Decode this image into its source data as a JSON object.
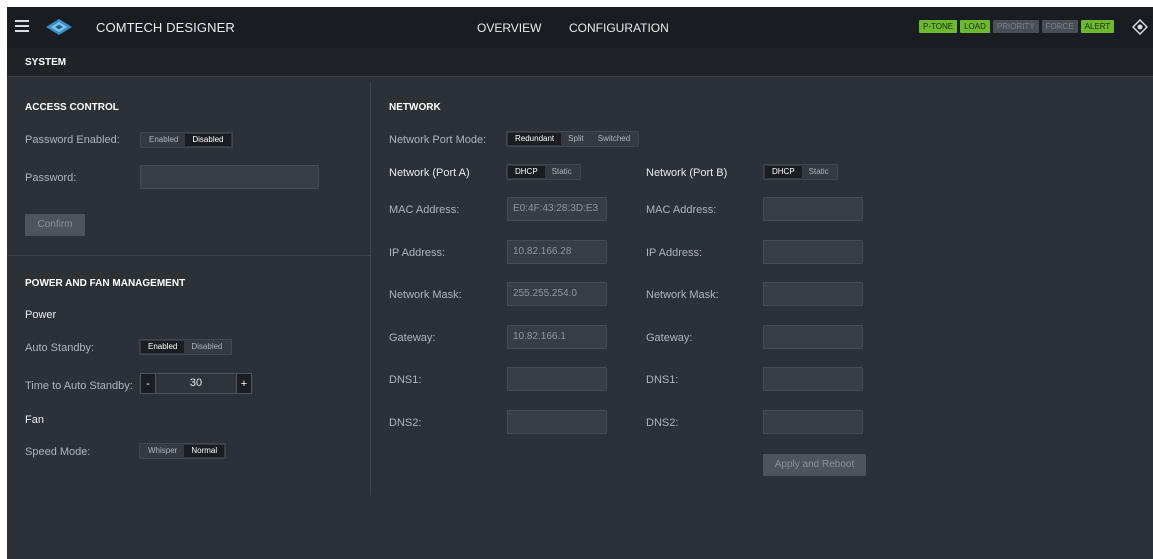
{
  "header": {
    "brand": "COMTECH DESIGNER",
    "nav": {
      "overview": "OVERVIEW",
      "configuration": "CONFIGURATION"
    },
    "badges": [
      {
        "label": "P-TONE",
        "active": true
      },
      {
        "label": "LOAD",
        "active": true
      },
      {
        "label": "PRIORITY",
        "active": false
      },
      {
        "label": "FORCE",
        "active": false
      },
      {
        "label": "ALERT",
        "active": true
      }
    ],
    "colors": {
      "bar": "#191c20",
      "active_badge": "#6db92d",
      "inactive_badge": "#494e55"
    }
  },
  "system": {
    "title": "SYSTEM"
  },
  "access_control": {
    "title": "ACCESS CONTROL",
    "password_enabled_label": "Password Enabled:",
    "password_enabled_options": [
      "Enabled",
      "Disabled"
    ],
    "password_enabled_selected": "Disabled",
    "password_label": "Password:",
    "password_value": "",
    "confirm_label": "Confirm"
  },
  "power_fan": {
    "title": "POWER AND FAN MANAGEMENT",
    "power_heading": "Power",
    "auto_standby_label": "Auto Standby:",
    "auto_standby_options": [
      "Enabled",
      "Disabled"
    ],
    "auto_standby_selected": "Enabled",
    "time_label": "Time to Auto Standby:",
    "time_minus": "-",
    "time_value": "30",
    "time_plus": "+",
    "fan_heading": "Fan",
    "speed_mode_label": "Speed Mode:",
    "speed_mode_options": [
      "Whisper",
      "Normal"
    ],
    "speed_mode_selected": "Normal"
  },
  "network": {
    "title": "NETWORK",
    "port_mode_label": "Network Port Mode:",
    "port_mode_options": [
      "Redundant",
      "Split",
      "Switched"
    ],
    "port_mode_selected": "Redundant",
    "port_a": {
      "title": "Network (Port A)",
      "mode_options": [
        "DHCP",
        "Static"
      ],
      "mode_selected": "DHCP",
      "mac_label": "MAC Address:",
      "mac_value": "E0:4F:43:28:3D:E3",
      "ip_label": "IP Address:",
      "ip_value": "10.82.166.28",
      "mask_label": "Network Mask:",
      "mask_value": "255.255.254.0",
      "gateway_label": "Gateway:",
      "gateway_value": "10.82.166.1",
      "dns1_label": "DNS1:",
      "dns1_value": "",
      "dns2_label": "DNS2:",
      "dns2_value": ""
    },
    "port_b": {
      "title": "Network (Port B)",
      "mode_options": [
        "DHCP",
        "Static"
      ],
      "mode_selected": "DHCP",
      "mac_label": "MAC Address:",
      "mac_value": "",
      "ip_label": "IP Address:",
      "ip_value": "",
      "mask_label": "Network Mask:",
      "mask_value": "",
      "gateway_label": "Gateway:",
      "gateway_value": "",
      "dns1_label": "DNS1:",
      "dns1_value": "",
      "dns2_label": "DNS2:",
      "dns2_value": ""
    },
    "apply_label": "Apply and Reboot"
  }
}
